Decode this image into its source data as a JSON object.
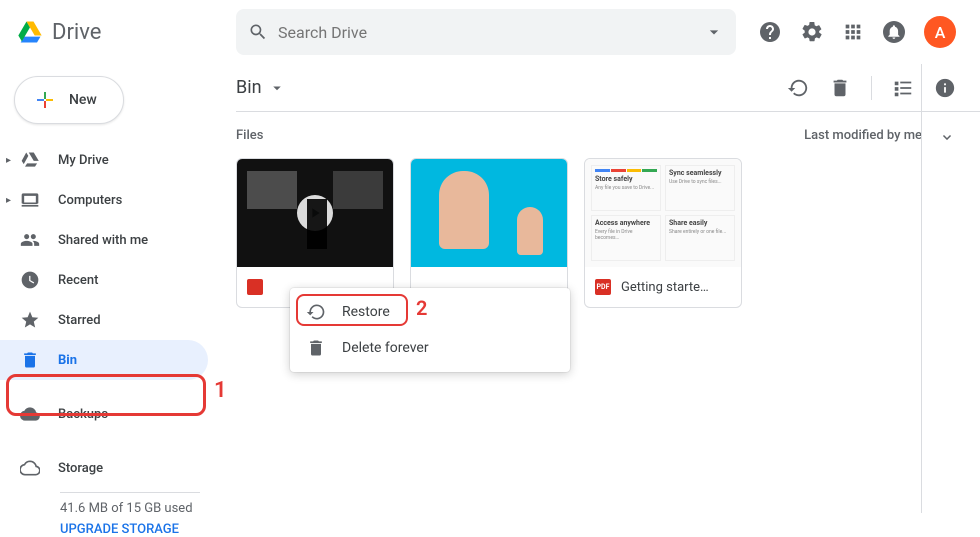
{
  "app": {
    "name": "Drive",
    "avatar_initial": "A"
  },
  "search": {
    "placeholder": "Search Drive"
  },
  "sidebar": {
    "new_label": "New",
    "items": [
      {
        "label": "My Drive"
      },
      {
        "label": "Computers"
      },
      {
        "label": "Shared with me"
      },
      {
        "label": "Recent"
      },
      {
        "label": "Starred"
      },
      {
        "label": "Bin"
      },
      {
        "label": "Backups"
      },
      {
        "label": "Storage"
      }
    ],
    "storage_used": "41.6 MB of 15 GB used",
    "upgrade_label": "UPGRADE STORAGE"
  },
  "toolbar": {
    "title": "Bin"
  },
  "content": {
    "section_label": "Files",
    "sort_label": "Last modified by me",
    "files": [
      {
        "name": "",
        "type": "video"
      },
      {
        "name": "",
        "type": "image"
      },
      {
        "name": "Getting starte…",
        "type": "pdf",
        "icon_text": "PDF"
      }
    ]
  },
  "doc_thumb": {
    "cells": [
      "Store safely",
      "Sync seamlessly",
      "Access anywhere",
      "Share easily"
    ]
  },
  "context_menu": {
    "restore": "Restore",
    "delete_forever": "Delete forever"
  },
  "annotations": {
    "one": "1",
    "two": "2"
  }
}
